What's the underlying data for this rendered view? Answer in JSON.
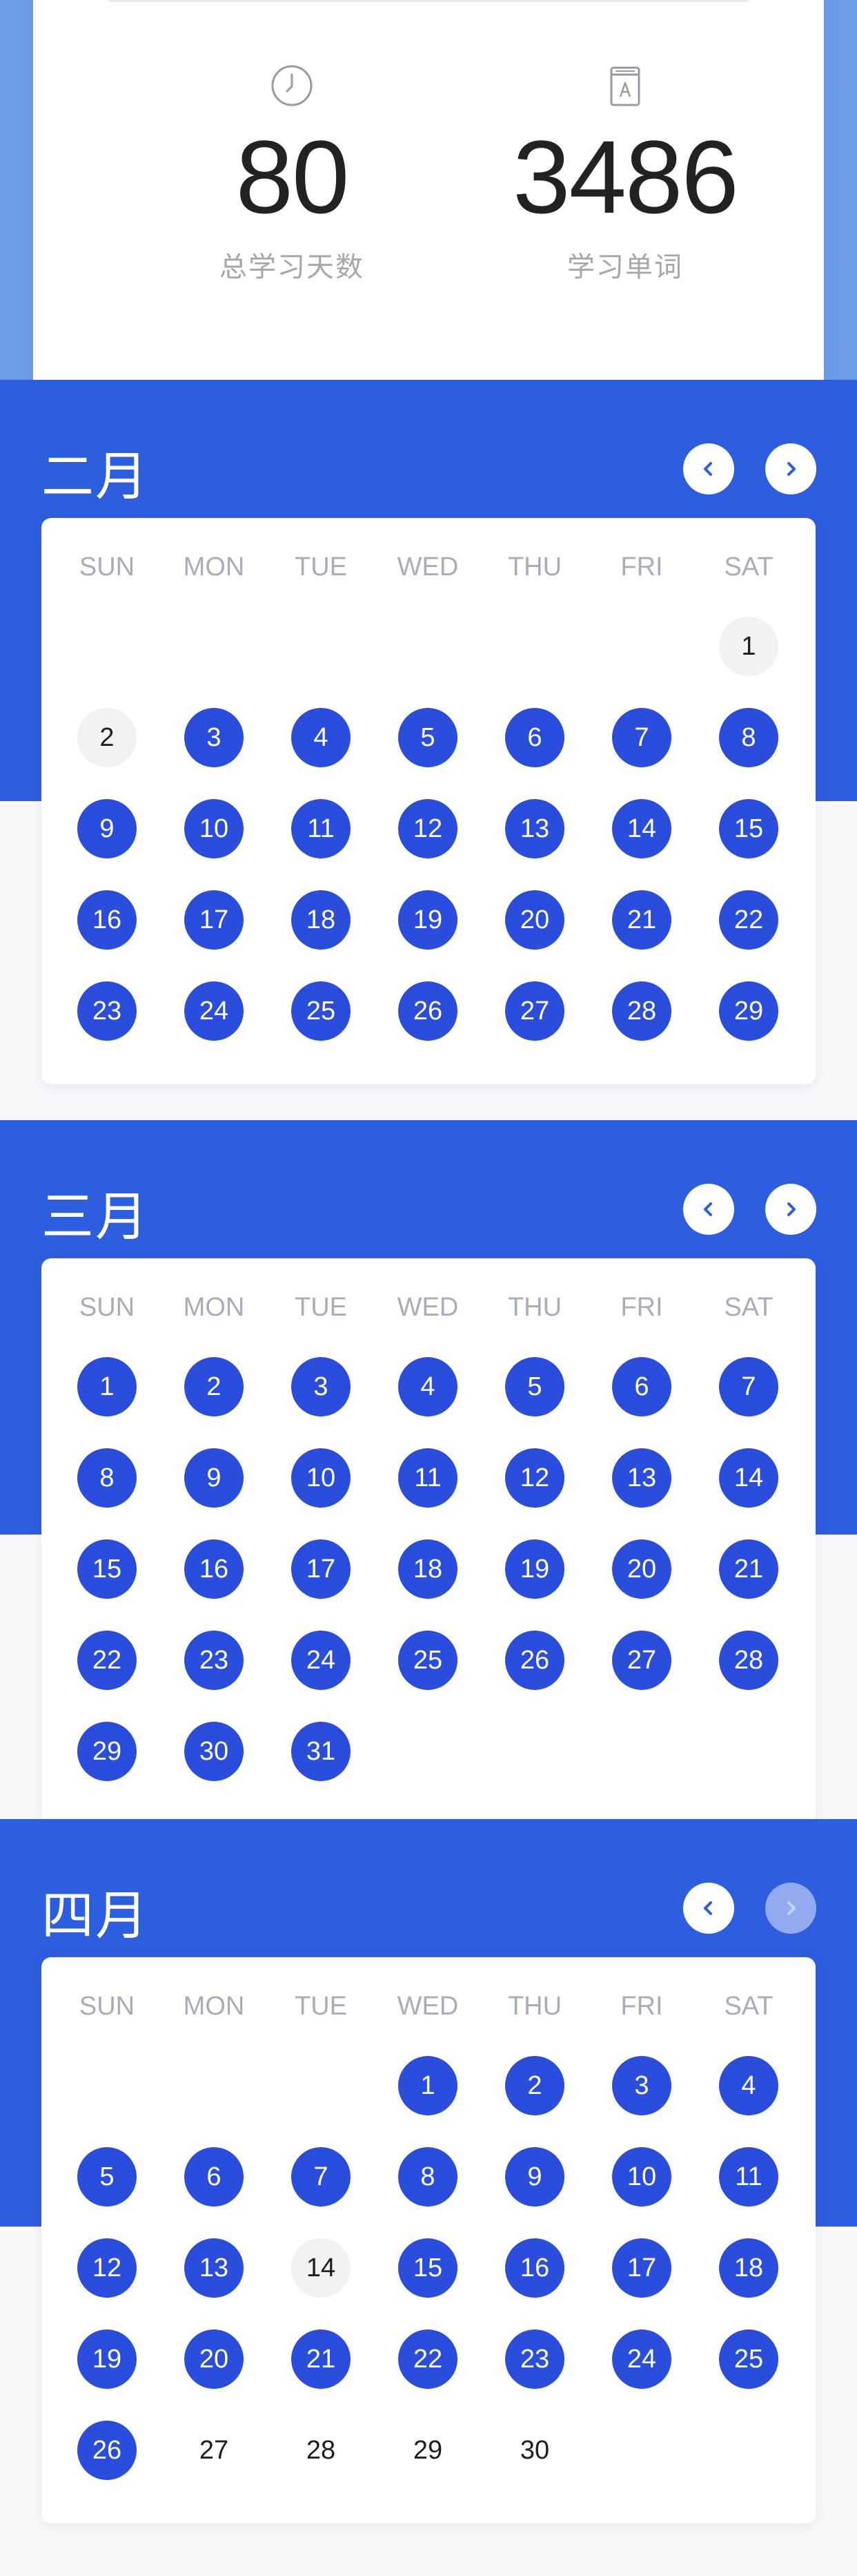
{
  "stats": {
    "total_days": {
      "value": "80",
      "label": "总学习天数",
      "icon": "clock-icon"
    },
    "words": {
      "value": "3486",
      "label": "学习单词",
      "icon": "book-icon"
    }
  },
  "colors": {
    "accent": "#2e5ee0",
    "studied_day": "#2a4ddb",
    "missed_day": "#f2f2f5",
    "weekday_text": "#a9acba"
  },
  "weekdays": [
    "SUN",
    "MON",
    "TUE",
    "WED",
    "THU",
    "FRI",
    "SAT"
  ],
  "months": [
    {
      "title": "二月",
      "next_enabled": true,
      "first_weekday": 6,
      "days": [
        {
          "d": "1",
          "s": "missed"
        },
        {
          "d": "2",
          "s": "missed"
        },
        {
          "d": "3",
          "s": "studied"
        },
        {
          "d": "4",
          "s": "studied"
        },
        {
          "d": "5",
          "s": "studied"
        },
        {
          "d": "6",
          "s": "studied"
        },
        {
          "d": "7",
          "s": "studied"
        },
        {
          "d": "8",
          "s": "studied"
        },
        {
          "d": "9",
          "s": "studied"
        },
        {
          "d": "10",
          "s": "studied"
        },
        {
          "d": "11",
          "s": "studied"
        },
        {
          "d": "12",
          "s": "studied"
        },
        {
          "d": "13",
          "s": "studied"
        },
        {
          "d": "14",
          "s": "studied"
        },
        {
          "d": "15",
          "s": "studied"
        },
        {
          "d": "16",
          "s": "studied"
        },
        {
          "d": "17",
          "s": "studied"
        },
        {
          "d": "18",
          "s": "studied"
        },
        {
          "d": "19",
          "s": "studied"
        },
        {
          "d": "20",
          "s": "studied"
        },
        {
          "d": "21",
          "s": "studied"
        },
        {
          "d": "22",
          "s": "studied"
        },
        {
          "d": "23",
          "s": "studied"
        },
        {
          "d": "24",
          "s": "studied"
        },
        {
          "d": "25",
          "s": "studied"
        },
        {
          "d": "26",
          "s": "studied"
        },
        {
          "d": "27",
          "s": "studied"
        },
        {
          "d": "28",
          "s": "studied"
        },
        {
          "d": "29",
          "s": "studied"
        }
      ]
    },
    {
      "title": "三月",
      "next_enabled": true,
      "first_weekday": 0,
      "days": [
        {
          "d": "1",
          "s": "studied"
        },
        {
          "d": "2",
          "s": "studied"
        },
        {
          "d": "3",
          "s": "studied"
        },
        {
          "d": "4",
          "s": "studied"
        },
        {
          "d": "5",
          "s": "studied"
        },
        {
          "d": "6",
          "s": "studied"
        },
        {
          "d": "7",
          "s": "studied"
        },
        {
          "d": "8",
          "s": "studied"
        },
        {
          "d": "9",
          "s": "studied"
        },
        {
          "d": "10",
          "s": "studied"
        },
        {
          "d": "11",
          "s": "studied"
        },
        {
          "d": "12",
          "s": "studied"
        },
        {
          "d": "13",
          "s": "studied"
        },
        {
          "d": "14",
          "s": "studied"
        },
        {
          "d": "15",
          "s": "studied"
        },
        {
          "d": "16",
          "s": "studied"
        },
        {
          "d": "17",
          "s": "studied"
        },
        {
          "d": "18",
          "s": "studied"
        },
        {
          "d": "19",
          "s": "studied"
        },
        {
          "d": "20",
          "s": "studied"
        },
        {
          "d": "21",
          "s": "studied"
        },
        {
          "d": "22",
          "s": "studied"
        },
        {
          "d": "23",
          "s": "studied"
        },
        {
          "d": "24",
          "s": "studied"
        },
        {
          "d": "25",
          "s": "studied"
        },
        {
          "d": "26",
          "s": "studied"
        },
        {
          "d": "27",
          "s": "studied"
        },
        {
          "d": "28",
          "s": "studied"
        },
        {
          "d": "29",
          "s": "studied"
        },
        {
          "d": "30",
          "s": "studied"
        },
        {
          "d": "31",
          "s": "studied"
        }
      ]
    },
    {
      "title": "四月",
      "next_enabled": false,
      "first_weekday": 3,
      "days": [
        {
          "d": "1",
          "s": "studied"
        },
        {
          "d": "2",
          "s": "studied"
        },
        {
          "d": "3",
          "s": "studied"
        },
        {
          "d": "4",
          "s": "studied"
        },
        {
          "d": "5",
          "s": "studied"
        },
        {
          "d": "6",
          "s": "studied"
        },
        {
          "d": "7",
          "s": "studied"
        },
        {
          "d": "8",
          "s": "studied"
        },
        {
          "d": "9",
          "s": "studied"
        },
        {
          "d": "10",
          "s": "studied"
        },
        {
          "d": "11",
          "s": "studied"
        },
        {
          "d": "12",
          "s": "studied"
        },
        {
          "d": "13",
          "s": "studied"
        },
        {
          "d": "14",
          "s": "missed"
        },
        {
          "d": "15",
          "s": "studied"
        },
        {
          "d": "16",
          "s": "studied"
        },
        {
          "d": "17",
          "s": "studied"
        },
        {
          "d": "18",
          "s": "studied"
        },
        {
          "d": "19",
          "s": "studied"
        },
        {
          "d": "20",
          "s": "studied"
        },
        {
          "d": "21",
          "s": "studied"
        },
        {
          "d": "22",
          "s": "studied"
        },
        {
          "d": "23",
          "s": "studied"
        },
        {
          "d": "24",
          "s": "studied"
        },
        {
          "d": "25",
          "s": "studied"
        },
        {
          "d": "26",
          "s": "studied"
        },
        {
          "d": "27",
          "s": "future"
        },
        {
          "d": "28",
          "s": "future"
        },
        {
          "d": "29",
          "s": "future"
        },
        {
          "d": "30",
          "s": "future"
        }
      ]
    }
  ]
}
